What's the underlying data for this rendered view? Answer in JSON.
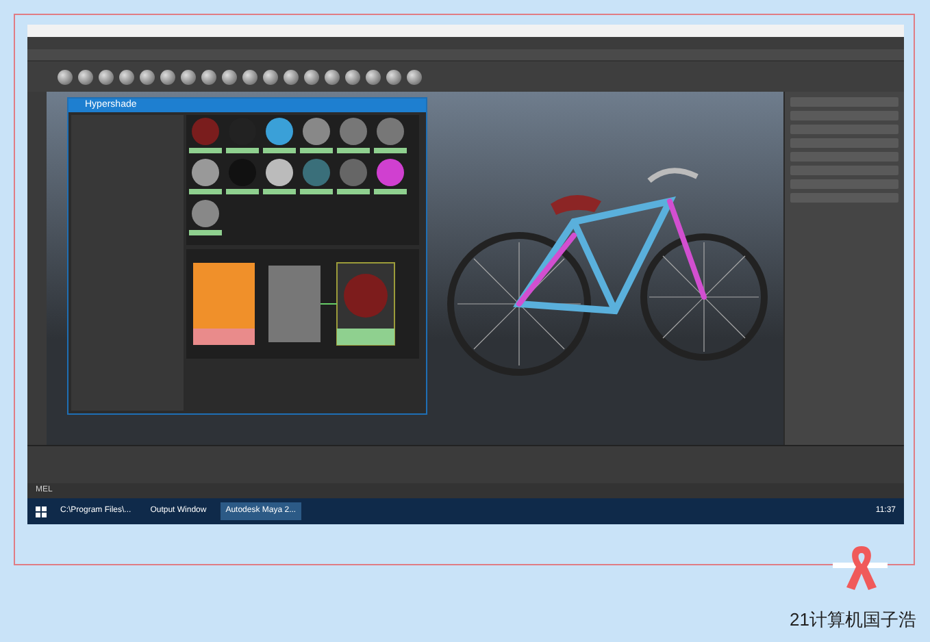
{
  "screenshot": {
    "hypershade": {
      "title": "Hypershade"
    },
    "command_line": {
      "label": "MEL"
    },
    "taskbar": {
      "items": [
        {
          "label": "C:\\Program Files\\...",
          "selected": false
        },
        {
          "label": "Output Window",
          "selected": false
        },
        {
          "label": "Autodesk Maya 2...",
          "selected": true
        }
      ],
      "time": "11:37"
    }
  },
  "caption": "21计算机国子浩"
}
